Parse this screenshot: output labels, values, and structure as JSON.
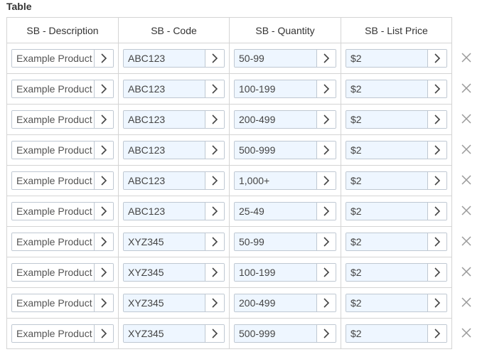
{
  "section": {
    "title": "Table"
  },
  "table": {
    "headers": [
      "SB - Description",
      "SB - Code",
      "SB - Quantity",
      "SB - List Price"
    ],
    "rows": [
      {
        "description": "Example Product",
        "code": "ABC123",
        "quantity": "50-99",
        "list_price": "$2"
      },
      {
        "description": "Example Product",
        "code": "ABC123",
        "quantity": "100-199",
        "list_price": "$2"
      },
      {
        "description": "Example Product",
        "code": "ABC123",
        "quantity": "200-499",
        "list_price": "$2"
      },
      {
        "description": "Example Product",
        "code": "ABC123",
        "quantity": "500-999",
        "list_price": "$2"
      },
      {
        "description": "Example Product",
        "code": "ABC123",
        "quantity": "1,000+",
        "list_price": "$2"
      },
      {
        "description": "Example Product",
        "code": "ABC123",
        "quantity": "25-49",
        "list_price": "$2"
      },
      {
        "description": "Example Product",
        "code": "XYZ345",
        "quantity": "50-99",
        "list_price": "$2"
      },
      {
        "description": "Example Product",
        "code": "XYZ345",
        "quantity": "100-199",
        "list_price": "$2"
      },
      {
        "description": "Example Product",
        "code": "XYZ345",
        "quantity": "200-499",
        "list_price": "$2"
      },
      {
        "description": "Example Product",
        "code": "XYZ345",
        "quantity": "500-999",
        "list_price": "$2"
      }
    ]
  },
  "icons": {
    "open": "chevron-right-icon",
    "delete": "close-icon"
  },
  "colors": {
    "field_fill": "#eef6ff",
    "border": "#d4d4d4",
    "icon": "#9a9a9a"
  }
}
